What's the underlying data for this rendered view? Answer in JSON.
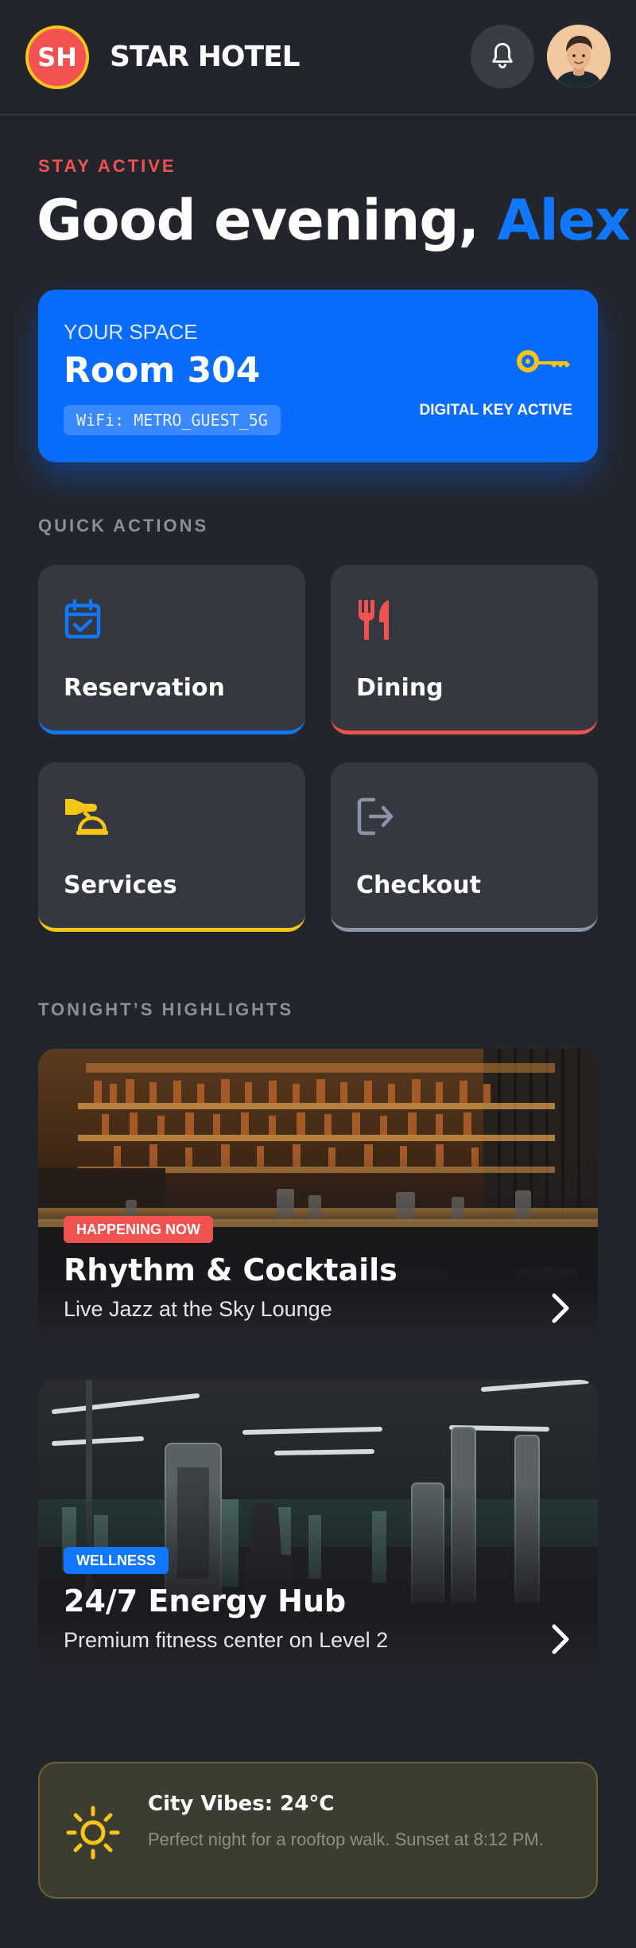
{
  "header": {
    "logo_initials": "SH",
    "brand": "STAR HOTEL",
    "bell_icon": "bell-icon",
    "avatar_icon": "user-avatar"
  },
  "greeting": {
    "eyebrow": "STAY ACTIVE",
    "salutation": "Good evening,",
    "name": "Alex"
  },
  "room": {
    "label": "YOUR SPACE",
    "name": "Room 304",
    "wifi": "WiFi: METRO_GUEST_5G",
    "key_status": "DIGITAL KEY ACTIVE",
    "key_icon": "key-icon"
  },
  "quick_actions": {
    "title": "QUICK ACTIONS",
    "items": [
      {
        "label": "Reservation",
        "icon": "calendar-check-icon",
        "accent": "#1177ff"
      },
      {
        "label": "Dining",
        "icon": "utensils-icon",
        "accent": "#f05252"
      },
      {
        "label": "Services",
        "icon": "concierge-bell-icon",
        "accent": "#f5c518"
      },
      {
        "label": "Checkout",
        "icon": "logout-icon",
        "accent": "#8a94a6"
      }
    ]
  },
  "highlights": {
    "title": "TONIGHT’S HIGHLIGHTS",
    "items": [
      {
        "badge": "HAPPENING NOW",
        "badge_color": "#f05252",
        "title": "Rhythm & Cocktails",
        "subtitle": "Live Jazz at the Sky Lounge"
      },
      {
        "badge": "WELLNESS",
        "badge_color": "#1177ff",
        "title": "24/7 Energy Hub",
        "subtitle": "Premium fitness center on Level 2"
      }
    ]
  },
  "weather": {
    "title": "City Vibes: 24°C",
    "text": "Perfect night for a rooftop walk. Sunset at 8:12 PM.",
    "icon": "sun-icon"
  },
  "colors": {
    "background": "#23252c",
    "card": "#363840",
    "primary_blue": "#1177ff",
    "accent_red": "#f05252",
    "accent_yellow": "#f5c518"
  }
}
